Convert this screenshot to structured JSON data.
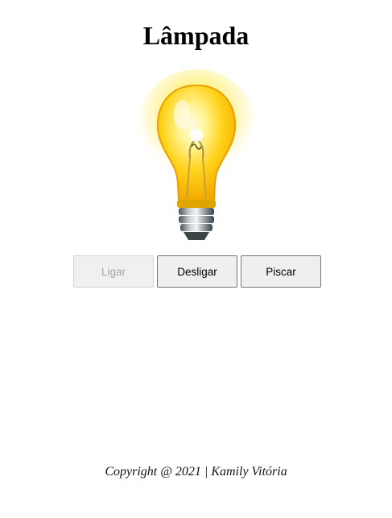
{
  "page": {
    "title": "Lâmpada"
  },
  "lamp": {
    "state": "on",
    "icon": "light-bulb-icon",
    "glow_color": "#ffe94d",
    "glass_color": "#ffd21a"
  },
  "controls": {
    "ligar_label": "Ligar",
    "ligar_disabled": true,
    "desligar_label": "Desligar",
    "piscar_label": "Piscar"
  },
  "footer": {
    "text": "Copyright @ 2021 | Kamily Vitória"
  }
}
